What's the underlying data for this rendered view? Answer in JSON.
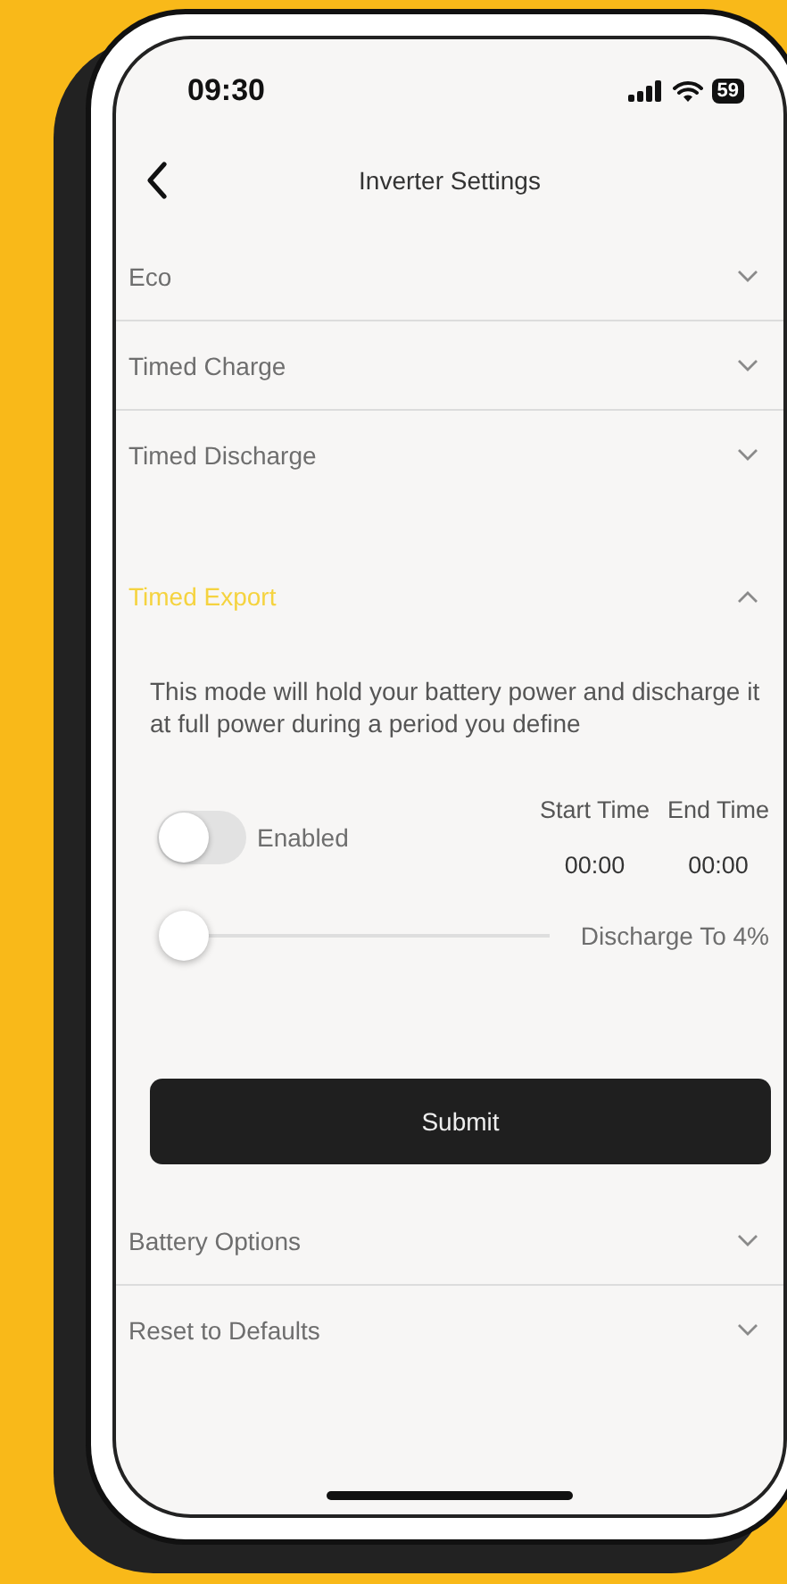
{
  "status_bar": {
    "time": "09:30",
    "battery": "59"
  },
  "header": {
    "title": "Inverter Settings"
  },
  "sections": [
    {
      "label": "Eco",
      "expanded": false
    },
    {
      "label": "Timed Charge",
      "expanded": false
    },
    {
      "label": "Timed Discharge",
      "expanded": false
    },
    {
      "label": "Timed Export",
      "expanded": true,
      "panel": {
        "description": "This mode will hold your battery power and discharge it at full power during a period you define",
        "toggle": {
          "label": "Enabled",
          "on": false
        },
        "times": [
          {
            "label": "Start Time",
            "value": "00:00"
          },
          {
            "label": "End Time",
            "value": "00:00"
          }
        ],
        "slider": {
          "level": 0.0,
          "label": "Discharge To 4%"
        },
        "submit": "Submit"
      }
    },
    {
      "label": "Battery Options",
      "expanded": false
    },
    {
      "label": "Reset to Defaults",
      "expanded": false
    }
  ]
}
